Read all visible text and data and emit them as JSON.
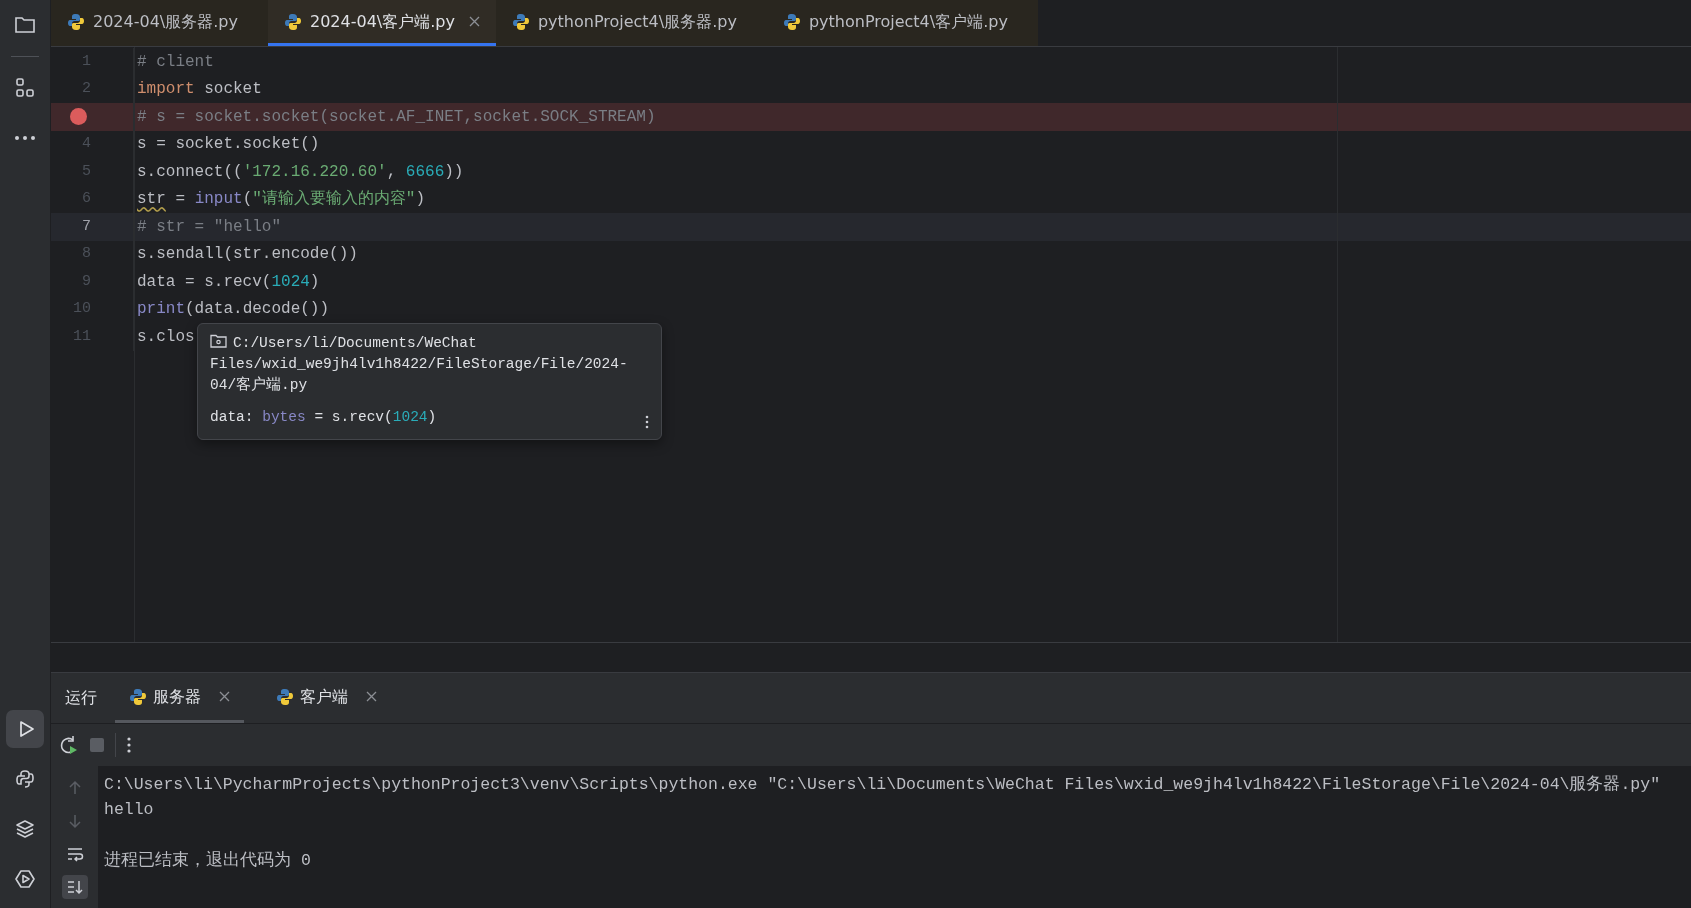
{
  "tool_buttons": [
    {
      "kind": "run",
      "selected": true
    },
    {
      "kind": "python",
      "selected": false
    },
    {
      "kind": "layers",
      "selected": false
    },
    {
      "kind": "services",
      "selected": false
    }
  ],
  "tabs": [
    {
      "label": "2024-04\\服务器.py",
      "selected": false
    },
    {
      "label": "2024-04\\客户端.py",
      "selected": true
    },
    {
      "label": "pythonProject4\\服务器.py",
      "selected": false
    },
    {
      "label": "pythonProject4\\客户端.py",
      "selected": false
    }
  ],
  "editor": {
    "lines": [
      {
        "number": "1",
        "breakpoint": false,
        "current": false,
        "tokens": [
          {
            "kind": "comment",
            "text": "# client"
          }
        ]
      },
      {
        "number": "2",
        "breakpoint": false,
        "current": false,
        "tokens": [
          {
            "kind": "keyword",
            "text": "import"
          },
          {
            "kind": "plain",
            "text": " socket"
          }
        ]
      },
      {
        "breakpoint": true,
        "current": false,
        "tokens": [
          {
            "kind": "comment",
            "text": "# s = socket.socket(socket.AF_INET,socket.SOCK_STREAM)"
          }
        ]
      },
      {
        "number": "4",
        "breakpoint": false,
        "current": false,
        "tokens": [
          {
            "kind": "plain",
            "text": "s = socket.socket()"
          }
        ]
      },
      {
        "number": "5",
        "breakpoint": false,
        "current": false,
        "tokens": [
          {
            "kind": "plain",
            "text": "s.connect(("
          },
          {
            "kind": "string",
            "text": "'172.16.220.60'"
          },
          {
            "kind": "plain",
            "text": ", "
          },
          {
            "kind": "number",
            "text": "6666"
          },
          {
            "kind": "plain",
            "text": "))"
          }
        ]
      },
      {
        "number": "6",
        "breakpoint": false,
        "current": false,
        "tokens": [
          {
            "kind": "warn",
            "text": "str"
          },
          {
            "kind": "plain",
            "text": " = "
          },
          {
            "kind": "builtin",
            "text": "input"
          },
          {
            "kind": "plain",
            "text": "("
          },
          {
            "kind": "string",
            "text": "\"请输入要输入的内容\""
          },
          {
            "kind": "plain",
            "text": ")"
          }
        ]
      },
      {
        "number": "7",
        "breakpoint": false,
        "current": true,
        "tokens": [
          {
            "kind": "comment",
            "text": "# str = \"hello\""
          }
        ]
      },
      {
        "number": "8",
        "breakpoint": false,
        "current": false,
        "tokens": [
          {
            "kind": "plain",
            "text": "s.sendall(str.encode())"
          }
        ]
      },
      {
        "number": "9",
        "breakpoint": false,
        "current": false,
        "tokens": [
          {
            "kind": "plain",
            "text": "data = s.recv("
          },
          {
            "kind": "number",
            "text": "1024"
          },
          {
            "kind": "plain",
            "text": ")"
          }
        ]
      },
      {
        "number": "10",
        "breakpoint": false,
        "current": false,
        "tokens": [
          {
            "kind": "builtin",
            "text": "print"
          },
          {
            "kind": "plain",
            "text": "(data.decode())"
          }
        ]
      },
      {
        "number": "11",
        "breakpoint": false,
        "current": false,
        "tokens": [
          {
            "kind": "plain",
            "text": "s.clos"
          }
        ]
      }
    ],
    "tooltip": {
      "path": "C:/Users/li/Documents/WeChat Files/wxid_we9jh4lv1h8422/FileStorage/File/2024-04/客户端.py",
      "tokens": [
        {
          "kind": "plain",
          "text": "data: "
        },
        {
          "kind": "builtin",
          "text": "bytes"
        },
        {
          "kind": "plain",
          "text": " = s.recv("
        },
        {
          "kind": "number",
          "text": "1024"
        },
        {
          "kind": "plain",
          "text": ")"
        }
      ]
    }
  },
  "run_panel": {
    "title": "运行",
    "tabs": [
      {
        "label": "服务器",
        "selected": true
      },
      {
        "label": "客户端",
        "selected": false
      }
    ],
    "tools": [
      {
        "kind": "up",
        "on": false
      },
      {
        "kind": "down",
        "on": false
      },
      {
        "kind": "wrap",
        "on": false
      },
      {
        "kind": "scroll-end",
        "on": true
      }
    ],
    "lines": [
      "C:\\Users\\li\\PycharmProjects\\pythonProject3\\venv\\Scripts\\python.exe \"C:\\Users\\li\\Documents\\WeChat Files\\wxid_we9jh4lv1h8422\\FileStorage\\File\\2024-04\\服务器.py\"",
      "hello"
    ],
    "exit_message": "进程已结束，退出代码为 0"
  }
}
